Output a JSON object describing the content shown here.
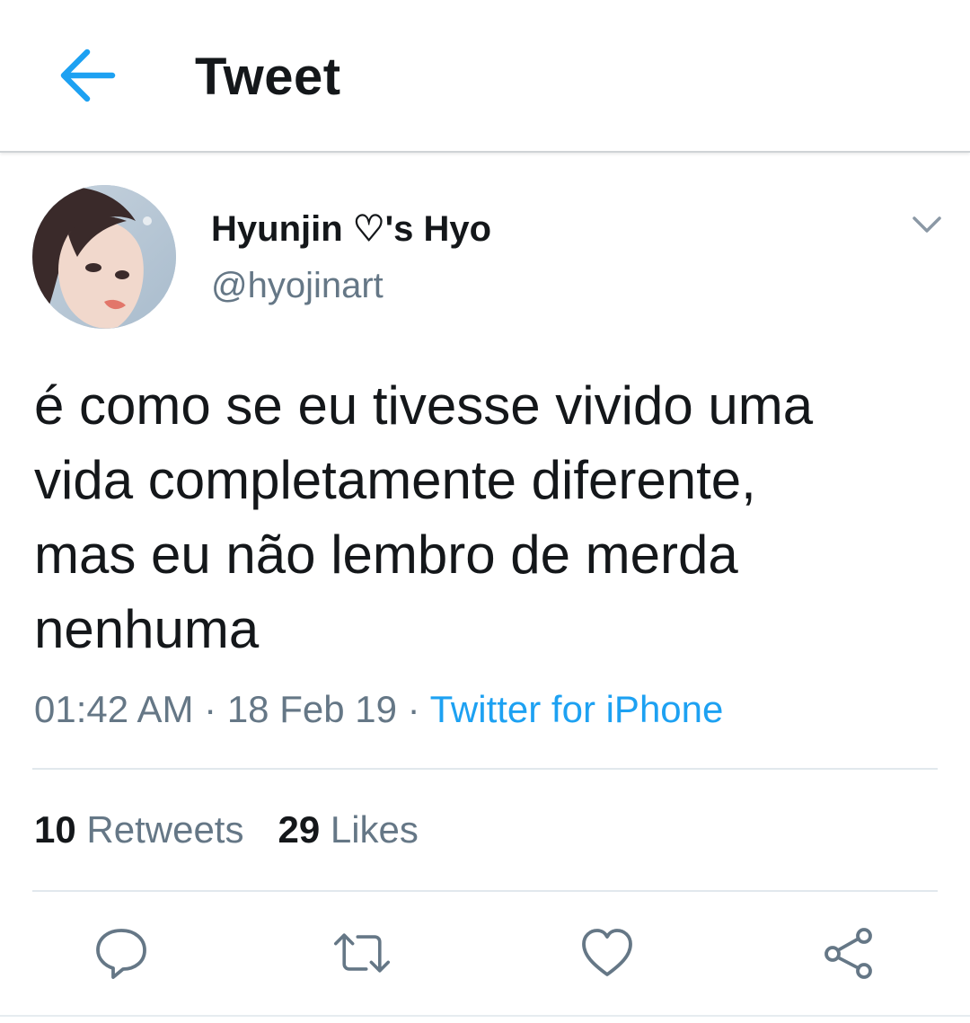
{
  "header": {
    "title": "Tweet",
    "back_icon": "arrow-left-icon",
    "accent_color": "#1da1f2"
  },
  "tweet": {
    "author": {
      "display_name": "Hyunjin ♡'s Hyo",
      "handle": "@hyojinart"
    },
    "text_lines": [
      "é como se eu tivesse vivido uma",
      "vida completamente diferente,",
      "mas eu não lembro de merda",
      "nenhuma"
    ],
    "time": "01:42 AM",
    "separator": "·",
    "date": "18 Feb 19",
    "source": "Twitter for iPhone",
    "stats": {
      "retweets_count": "10",
      "retweets_label": "Retweets",
      "likes_count": "29",
      "likes_label": "Likes"
    }
  },
  "actions": [
    {
      "icon": "reply-icon"
    },
    {
      "icon": "retweet-icon"
    },
    {
      "icon": "heart-icon"
    },
    {
      "icon": "share-icon"
    }
  ],
  "colors": {
    "text_primary": "#14171a",
    "text_secondary": "#657786",
    "link": "#1da1f2",
    "divider": "#e1e8ed"
  }
}
